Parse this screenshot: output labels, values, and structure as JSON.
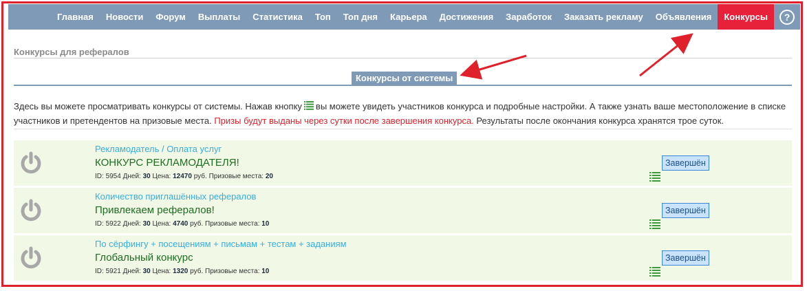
{
  "nav": {
    "items": [
      "Главная",
      "Новости",
      "Форум",
      "Выплаты",
      "Статистика",
      "Топ",
      "Топ дня",
      "Карьера",
      "Достижения",
      "Заработок",
      "Заказать рекламу",
      "Объявления",
      "Конкурсы"
    ],
    "active": "Конкурсы",
    "help_icon": "?"
  },
  "page_title": "Конкурсы для рефералов",
  "section_tab": "Конкурсы от системы",
  "description": {
    "part1": "Здесь вы можете просматривать конкурсы от системы. Нажав кнопку",
    "part2": "вы можете увидеть участников конкурса и подробные настройки. А также узнать ваше местоположение в списке участников и претендентов на призовые места.",
    "red": "Призы будут выданы через сутки после завершения конкурса.",
    "part3": "Результаты после окончания конкурса хранятся трое суток."
  },
  "contest_labels": {
    "id": "ID:",
    "days": "Дней:",
    "price": "Цена:",
    "currency": "руб.",
    "places": "Призовые места:"
  },
  "contests": [
    {
      "category": "Рекламодатель / Оплата услуг",
      "name": "КОНКУРС РЕКЛАМОДАТЕЛЯ!",
      "id": "5954",
      "days": "30",
      "price": "12470",
      "places": "20",
      "status": "Завершён"
    },
    {
      "category": "Количество приглашённых рефералов",
      "name": "Привлекаем рефералов!",
      "id": "5922",
      "days": "30",
      "price": "4740",
      "places": "10",
      "status": "Завершён"
    },
    {
      "category": "По сёрфингу + посещениям + письмам + тестам + заданиям",
      "name": "Глобальный конкурс",
      "id": "5921",
      "days": "30",
      "price": "1320",
      "places": "10",
      "status": "Завершён"
    }
  ],
  "colors": {
    "nav_bg": "#7e9ab6",
    "nav_active": "#e8213a",
    "annotation_red": "#e0202a",
    "contest_bg": "#f1f8e6",
    "category_blue": "#36aee0",
    "name_green": "#1c6e21"
  }
}
